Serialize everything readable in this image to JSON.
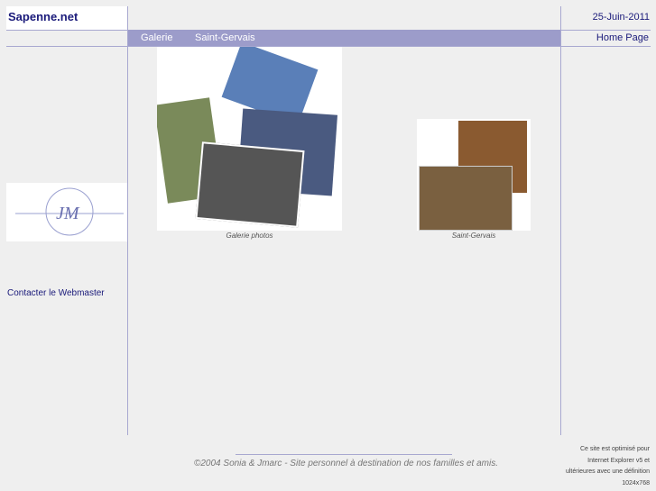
{
  "header": {
    "site_title": "Sapenne.net",
    "date": "25-Juin-2011",
    "home_link": "Home Page"
  },
  "nav": {
    "items": [
      "Galerie",
      "Saint-Gervais"
    ]
  },
  "gallery": [
    {
      "caption": "Galerie photos"
    },
    {
      "caption": "Saint-Gervais"
    }
  ],
  "sidebar": {
    "contact_link": "Contacter le Webmaster"
  },
  "footer": {
    "copyright": "©2004 Sonia & Jmarc - Site personnel à destination de nos familles et amis.",
    "optimized_lines": [
      "Ce site est optimisé pour",
      "Internet Explorer v5 et",
      "ultérieures avec une définition",
      "1024x768"
    ]
  }
}
